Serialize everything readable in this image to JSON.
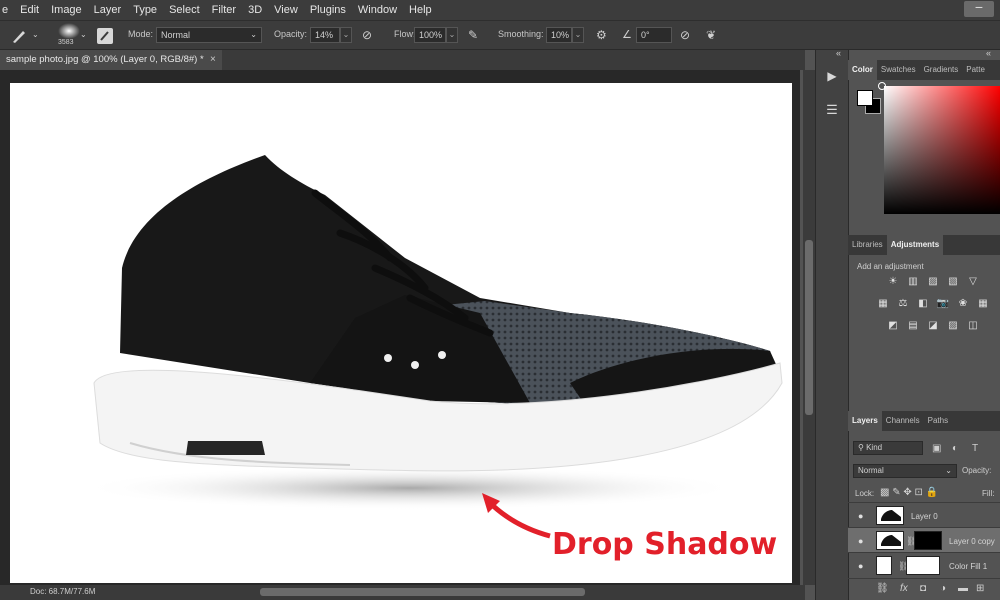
{
  "menu": [
    "e",
    "Edit",
    "Image",
    "Layer",
    "Type",
    "Select",
    "Filter",
    "3D",
    "View",
    "Plugins",
    "Window",
    "Help"
  ],
  "window_btn": "−",
  "options": {
    "brush_size": "3583",
    "mode_label": "Mode:",
    "mode_value": "Normal",
    "opacity_label": "Opacity:",
    "opacity_value": "14%",
    "flow_label": "Flow:",
    "flow_value": "100%",
    "smoothing_label": "Smoothing:",
    "smoothing_value": "10%",
    "angle_value": "0°"
  },
  "document": {
    "tab_title": "sample photo.jpg @ 100% (Layer 0, RGB/8#) *",
    "close": "×",
    "annotation": "Drop Shadow",
    "status": "Doc: 68.7M/77.6M"
  },
  "collapse_arrows": "«",
  "color_panel": {
    "tabs": [
      "Color",
      "Swatches",
      "Gradients",
      "Patte"
    ]
  },
  "adjust_panel": {
    "tabs": [
      "Libraries",
      "Adjustments"
    ],
    "hint": "Add an adjustment",
    "rows": [
      [
        "sun-icon",
        "levels-icon",
        "curves-icon",
        "exposure-icon",
        "triangle-icon"
      ],
      [
        "grid-icon",
        "scale-icon",
        "halfbox-icon",
        "camera-icon",
        "colorball-icon",
        "table-icon"
      ],
      [
        "invert-icon",
        "posterize-icon",
        "threshold-icon",
        "gradient-icon",
        "selective-icon"
      ]
    ],
    "glyphs": [
      [
        "☀",
        "▥",
        "▨",
        "▧",
        "▽"
      ],
      [
        "▦",
        "⚖",
        "◧",
        "📷",
        "❀",
        "▦"
      ],
      [
        "◩",
        "▤",
        "◪",
        "▨",
        "◫"
      ]
    ]
  },
  "layers_panel": {
    "tabs": [
      "Layers",
      "Channels",
      "Paths"
    ],
    "kind": "Kind",
    "blend": "Normal",
    "opacity_label": "Opacity:",
    "lock_label": "Lock:",
    "fill_label": "Fill:",
    "layers": [
      {
        "name": "Layer 0",
        "selected": false
      },
      {
        "name": "Layer 0 copy",
        "selected": true
      },
      {
        "name": "Color Fill 1",
        "selected": false
      }
    ]
  }
}
